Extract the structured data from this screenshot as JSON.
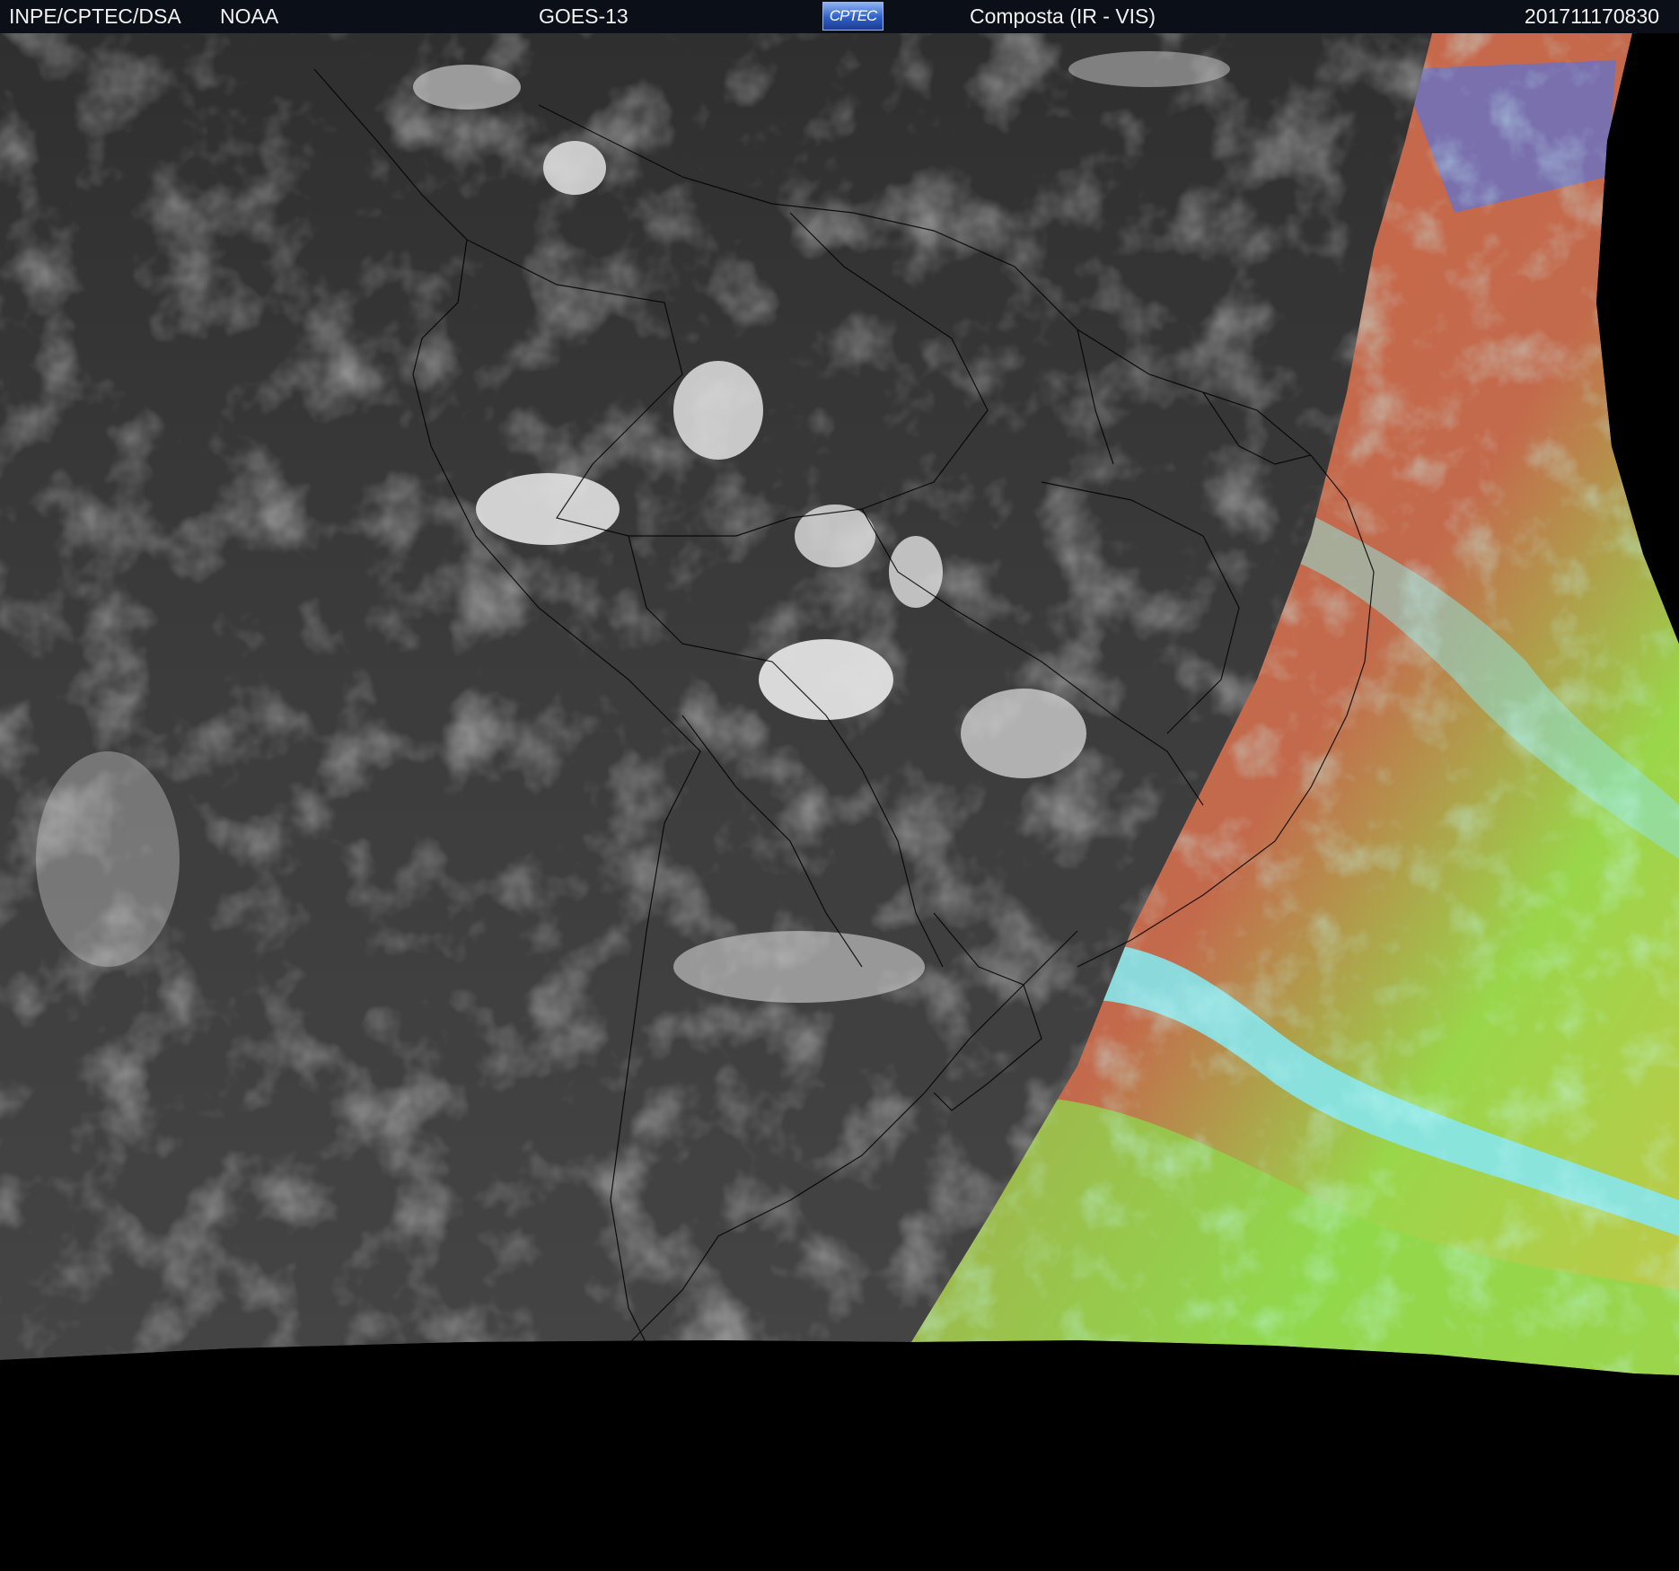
{
  "header": {
    "org": "INPE/CPTEC/DSA",
    "agency": "NOAA",
    "satellite": "GOES-13",
    "logo_text": "CPTEC",
    "product": "Composta (IR - VIS)",
    "timestamp": "201711170830"
  },
  "colors": {
    "header_bg": "#0b1018",
    "space": "#000000",
    "ir_background": "#3a3a3a",
    "ir_cloud": "#e6e6e6",
    "vis_warm": "#c8674a",
    "vis_green": "#9ad64a",
    "vis_cyan": "#7fe6ee",
    "vis_blue": "#5a74d8",
    "border_lines": "#000000"
  }
}
